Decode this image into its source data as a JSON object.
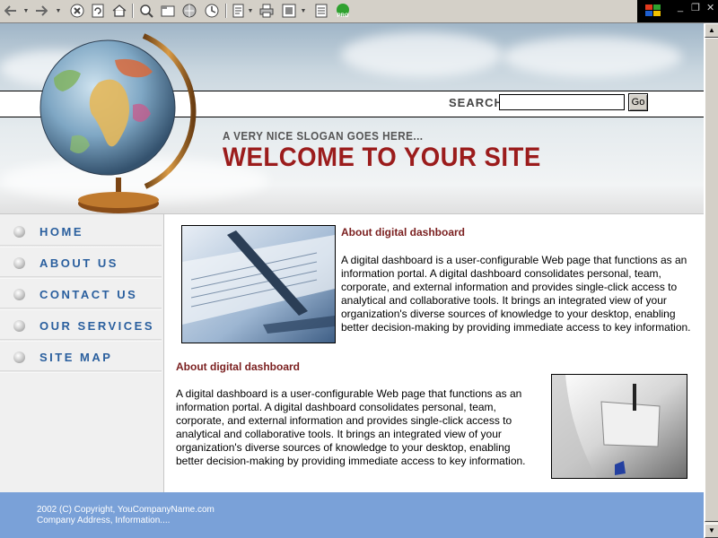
{
  "toolbar": {
    "icons": [
      "back-icon",
      "forward-icon",
      "stop-icon",
      "refresh-icon",
      "home-icon",
      "search-icon",
      "favorites-icon",
      "media-icon",
      "history-icon",
      "mail-icon",
      "print-icon",
      "edit-icon",
      "discuss-icon",
      "pro-icon"
    ]
  },
  "header": {
    "search_label": "SEARCH",
    "search_placeholder": "",
    "go_label": "Go",
    "slogan": "A VERY NICE SLOGAN GOES HERE...",
    "welcome": "WELCOME TO YOUR SITE"
  },
  "nav": {
    "items": [
      {
        "label": "HOME"
      },
      {
        "label": "ABOUT US"
      },
      {
        "label": "CONTACT US"
      },
      {
        "label": "OUR SERVICES"
      },
      {
        "label": "SITE MAP"
      }
    ]
  },
  "content": {
    "section1": {
      "heading": "About digital dashboard",
      "body": "A digital dashboard is a user-configurable Web page that functions as an information portal. A digital dashboard consolidates personal, team, corporate, and external information and provides single-click access to analytical and collaborative tools. It brings an integrated view of your organization's diverse sources of knowledge to your desktop, enabling better decision-making by providing immediate access to key information."
    },
    "section2": {
      "heading": "About digital dashboard",
      "body": "A digital dashboard is a user-configurable Web page that functions as an information portal. A digital dashboard consolidates personal, team, corporate, and external information and provides single-click access to analytical and collaborative tools. It brings an integrated view of your organization's diverse sources of knowledge to your desktop, enabling better decision-making by providing immediate access to key information."
    }
  },
  "footer": {
    "copyright": "2002 (C) Copyright, YouCompanyName.com",
    "address": "Company Address, Information...."
  },
  "colors": {
    "accent_red": "#9b1c1c",
    "nav_blue": "#2a5f9e",
    "footer_blue": "#7aa1d8"
  }
}
